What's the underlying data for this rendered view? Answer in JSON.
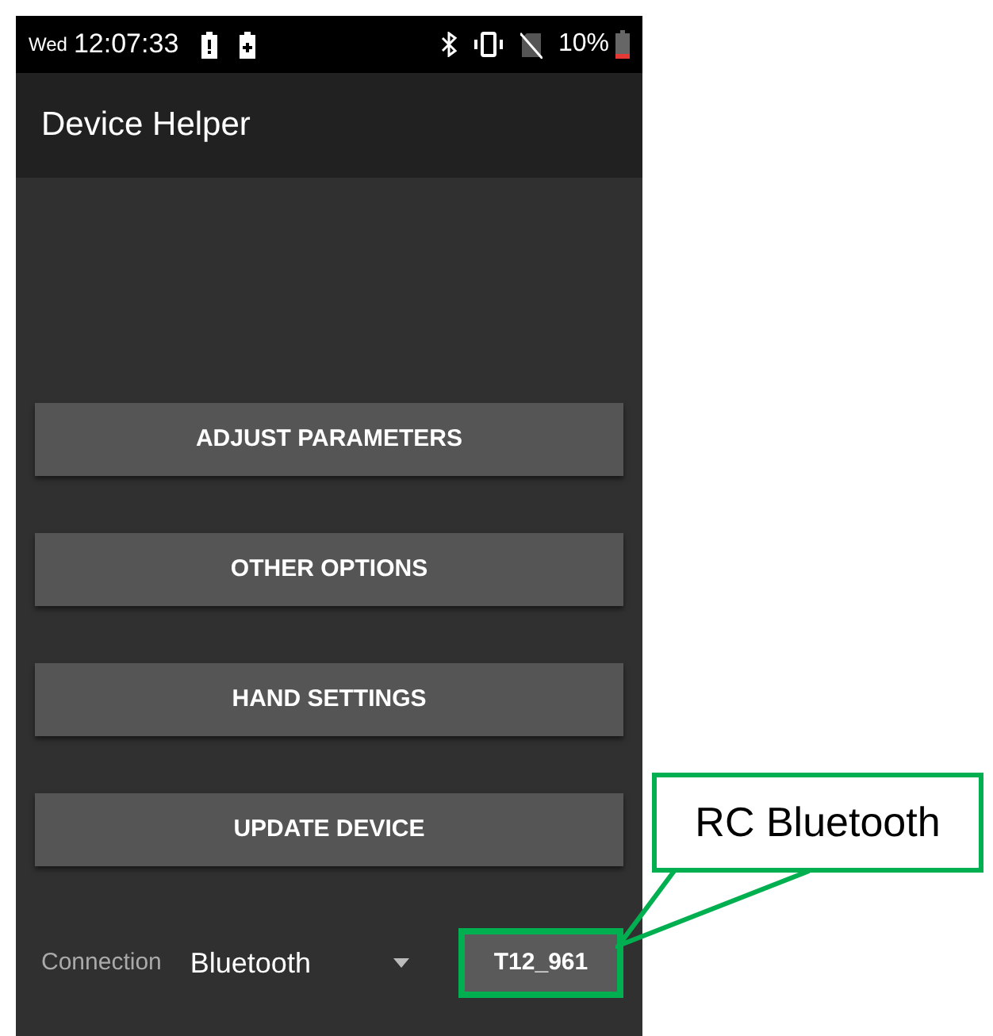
{
  "status_bar": {
    "day": "Wed",
    "time": "12:07:33",
    "battery": "10%"
  },
  "app_bar": {
    "title": "Device Helper"
  },
  "buttons": [
    {
      "label": "ADJUST PARAMETERS"
    },
    {
      "label": "OTHER OPTIONS"
    },
    {
      "label": "HAND SETTINGS"
    },
    {
      "label": "UPDATE DEVICE"
    }
  ],
  "connection": {
    "label": "Connection",
    "value": "Bluetooth"
  },
  "device_button": {
    "label": "T12_961",
    "highlighted": true
  },
  "callout": {
    "text": "RC Bluetooth"
  }
}
